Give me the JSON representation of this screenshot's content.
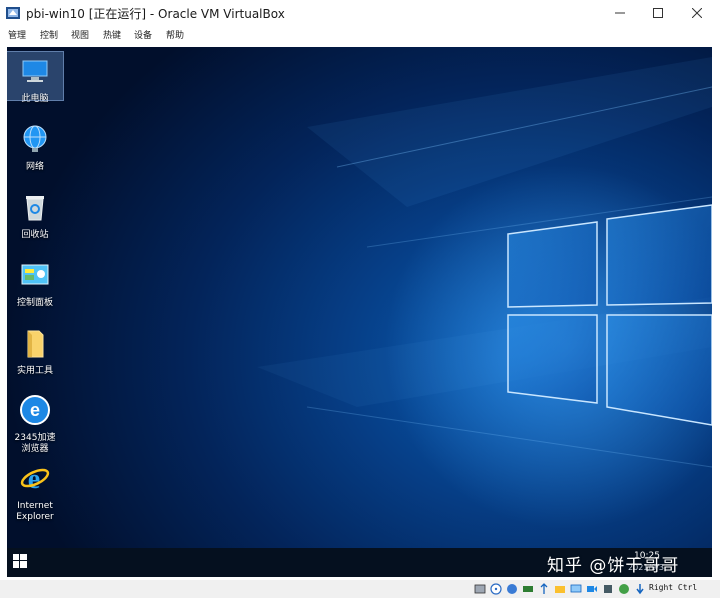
{
  "window": {
    "title": "pbi-win10 [正在运行] - Oracle VM VirtualBox",
    "icon": "virtualbox-icon",
    "controls": [
      "minimize",
      "maximize",
      "close"
    ]
  },
  "menu": {
    "items": [
      "管理",
      "控制",
      "视图",
      "热键",
      "设备",
      "帮助"
    ]
  },
  "desktop": {
    "icons": [
      {
        "label": "此电脑",
        "icon": "this-pc-icon",
        "selected": true
      },
      {
        "label": "网络",
        "icon": "network-icon"
      },
      {
        "label": "回收站",
        "icon": "recycle-bin-icon"
      },
      {
        "label": "控制面板",
        "icon": "control-panel-icon"
      },
      {
        "label": "实用工具",
        "icon": "folder-icon"
      },
      {
        "label": "2345加速浏览器",
        "icon": "browser-2345-icon"
      },
      {
        "label": "Internet Explorer",
        "icon": "internet-explorer-icon"
      }
    ],
    "colors": {
      "wallpaper": "#0a5fb8",
      "taskbar": "#05101f"
    }
  },
  "taskbar": {
    "clock_time": "10:25",
    "clock_date": "2021/9/3"
  },
  "watermark": "知乎 @饼干哥哥",
  "statusbar": {
    "host_key": "Right Ctrl"
  }
}
